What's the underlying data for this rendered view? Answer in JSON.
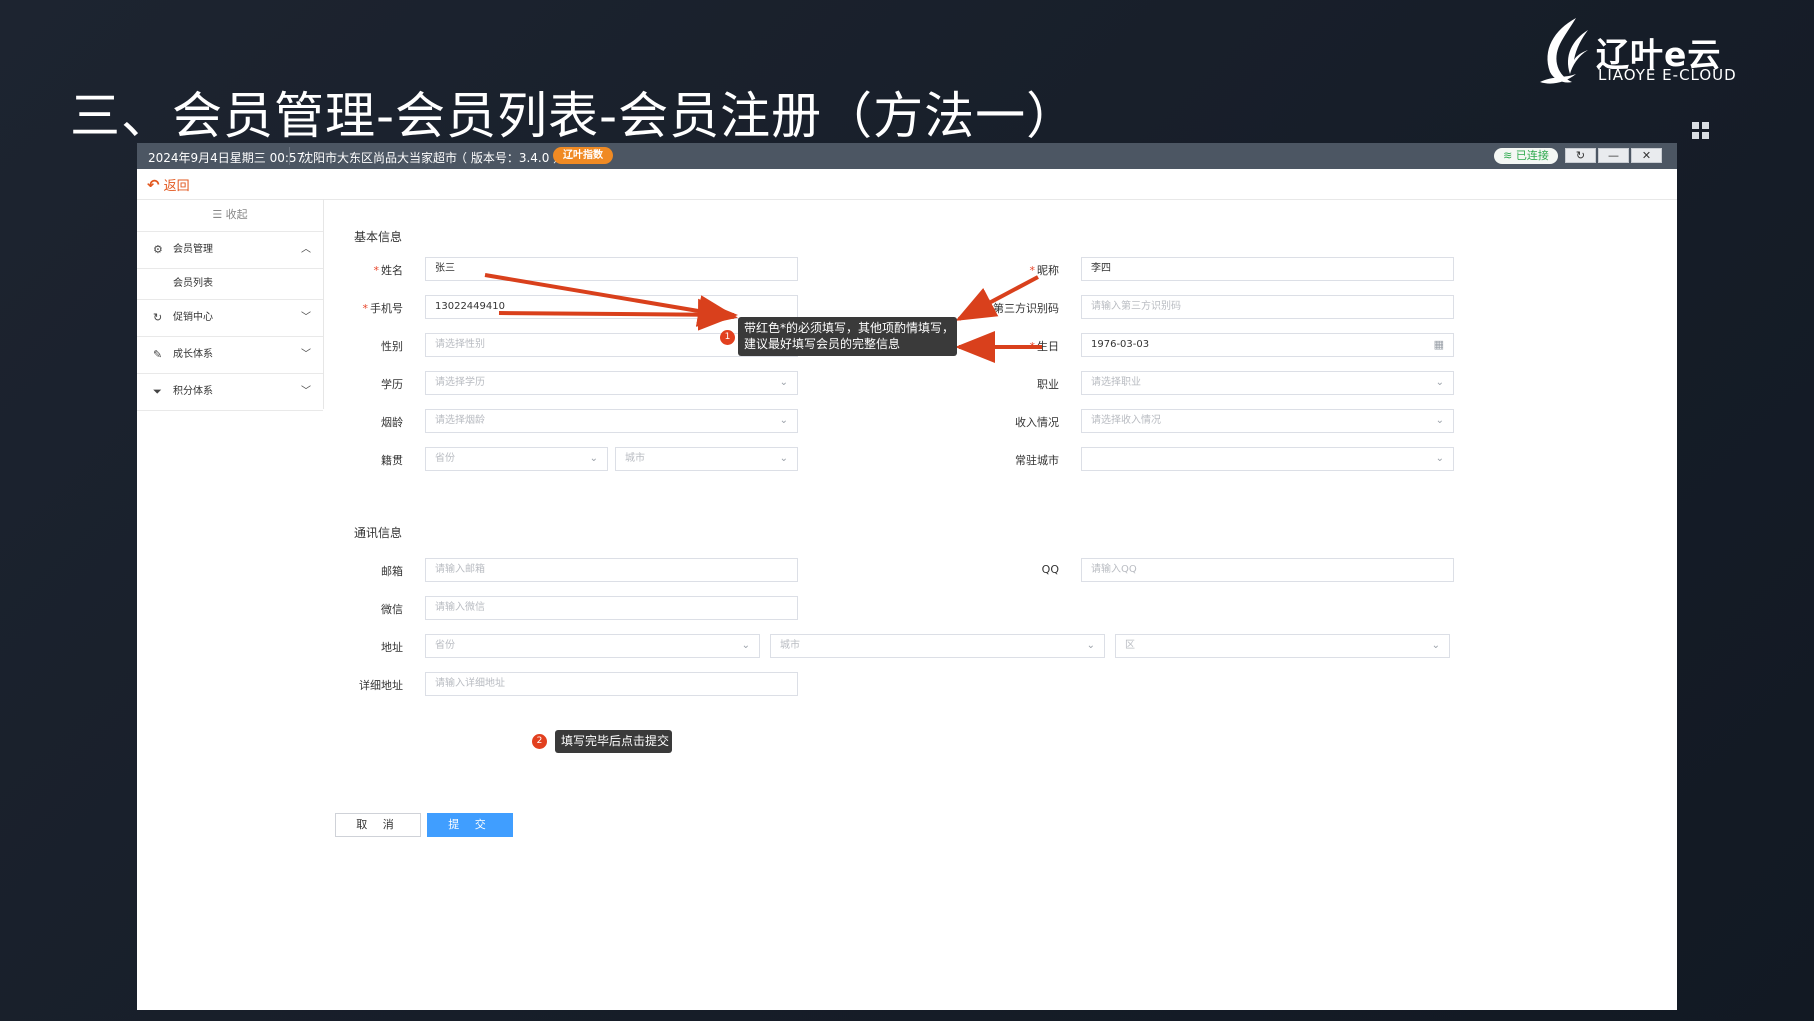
{
  "slide": {
    "title": "三、会员管理-会员列表-会员注册（方法一）",
    "logo_cn": "辽叶e云",
    "logo_en": "LIAOYE E-CLOUD"
  },
  "topbar": {
    "datetime": "2024年9月4日星期三 00:57",
    "store": "沈阳市大东区尚品大当家超市",
    "version": "（ 版本号：3.4.0 ）",
    "brand_badge": "辽叶指数",
    "connection": "已连接",
    "refresh_icon": "refresh-icon",
    "minimize_icon": "minimize-icon",
    "close_icon": "close-icon"
  },
  "nav": {
    "back_label": "返回"
  },
  "sidebar": {
    "collapse_label": "收起",
    "items": [
      {
        "label": "会员管理",
        "icon": "gear-icon",
        "expanded": true,
        "sub": [
          "会员列表"
        ]
      },
      {
        "label": "促销中心",
        "icon": "refresh-icon",
        "expanded": false
      },
      {
        "label": "成长体系",
        "icon": "pencil-icon",
        "expanded": false
      },
      {
        "label": "积分体系",
        "icon": "filter-icon",
        "expanded": false
      }
    ]
  },
  "form": {
    "basic_title": "基本信息",
    "contact_title": "通讯信息",
    "name": {
      "label": "姓名",
      "value": "张三"
    },
    "nickname": {
      "label": "昵称",
      "value": "李四"
    },
    "phone": {
      "label": "手机号",
      "value": "13022449410"
    },
    "third_id": {
      "label": "第三方识别码",
      "placeholder": "请输入第三方识别码"
    },
    "gender": {
      "label": "性别",
      "placeholder": "请选择性别"
    },
    "birthday": {
      "label": "生日",
      "value": "1976-03-03"
    },
    "education": {
      "label": "学历",
      "placeholder": "请选择学历"
    },
    "occupation": {
      "label": "职业",
      "placeholder": "请选择职业"
    },
    "smoking": {
      "label": "烟龄",
      "placeholder": "请选择烟龄"
    },
    "income": {
      "label": "收入情况",
      "placeholder": "请选择收入情况"
    },
    "origin": {
      "label": "籍贯",
      "province_placeholder": "省份",
      "city_placeholder": "城市"
    },
    "residence": {
      "label": "常驻城市",
      "value": ""
    },
    "email": {
      "label": "邮箱",
      "placeholder": "请输入邮箱"
    },
    "qq": {
      "label": "QQ",
      "placeholder": "请输入QQ"
    },
    "wechat": {
      "label": "微信",
      "placeholder": "请输入微信"
    },
    "address": {
      "label": "地址",
      "province_placeholder": "省份",
      "city_placeholder": "城市",
      "district_placeholder": "区"
    },
    "address_detail": {
      "label": "详细地址",
      "placeholder": "请输入详细地址"
    },
    "cancel_label": "取 消",
    "submit_label": "提 交"
  },
  "annotations": {
    "note1_num": "1",
    "note1_line1": "带红色*的必须填写，其他项酌情填写，",
    "note1_line2": "建议最好填写会员的完整信息",
    "note2_num": "2",
    "note2_text": "填写完毕后点击提交",
    "arrow_color": "#d9401c"
  },
  "colors": {
    "accent": "#409eff",
    "required": "#e8452a",
    "back": "#e2571e"
  }
}
